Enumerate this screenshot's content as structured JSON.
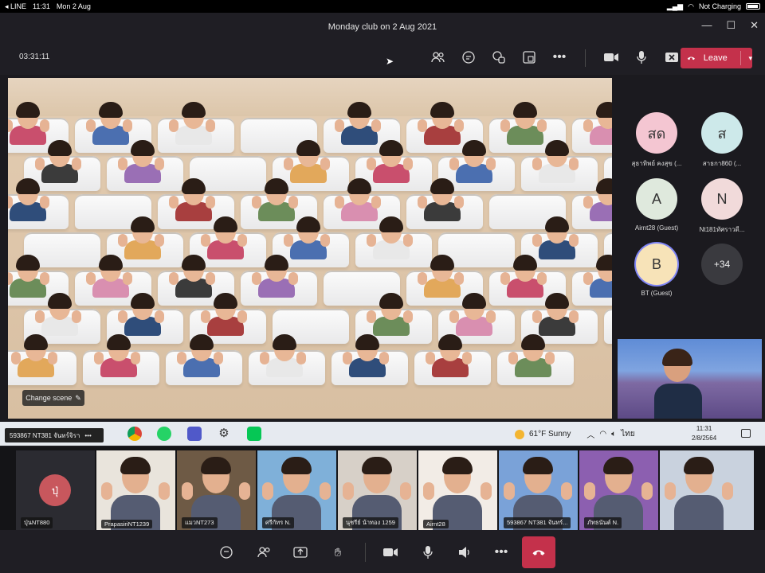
{
  "status_bar": {
    "back_app": "LINE",
    "time": "11:31",
    "date": "Mon 2 Aug",
    "battery_text": "Not Charging"
  },
  "window": {
    "title": "Monday club on 2 Aug 2021"
  },
  "toolbar": {
    "timer": "03:31:11",
    "leave_label": "Leave",
    "leave_color": "#c4314b"
  },
  "stage": {
    "change_scene_label": "Change scene"
  },
  "participants_panel": {
    "items": [
      {
        "initials": "สด",
        "name": "สุธาทิพย์ คงสุข (...",
        "color": "#f4c6d2"
      },
      {
        "initials": "ส",
        "name": "สาธกา860 (...",
        "color": "#cde9ea"
      },
      {
        "initials": "A",
        "name": "Airnt28 (Guest)",
        "color": "#dfe9dd"
      },
      {
        "initials": "N",
        "name": "Nt181ทัศราวดี...",
        "color": "#f1dada"
      },
      {
        "initials": "B",
        "name": "BT (Guest)",
        "color": "#f7e3b8"
      },
      {
        "initials": "+34",
        "name": "",
        "color": "#3a3a3f"
      }
    ]
  },
  "taskbar": {
    "task_label": "593867 NT381 จันทร์จิรา",
    "weather": "61°F  Sunny",
    "lang": "ไทย",
    "clock_time": "11:31",
    "clock_date": "2/8/2564"
  },
  "gallery": {
    "tiles": [
      {
        "name": "ปุ่นNT880",
        "initials": "ปุ่",
        "avatar": true
      },
      {
        "name": "PrapasiriNT1239"
      },
      {
        "name": "แมวNT273"
      },
      {
        "name": "ศรีกัทร N."
      },
      {
        "name": "นุชรีย์ น้าทอง 1259"
      },
      {
        "name": "Airnt28"
      },
      {
        "name": "593867 NT381 จันทร์..."
      },
      {
        "name": "ภัทธนันต์ N."
      },
      {
        "name": ""
      }
    ]
  }
}
